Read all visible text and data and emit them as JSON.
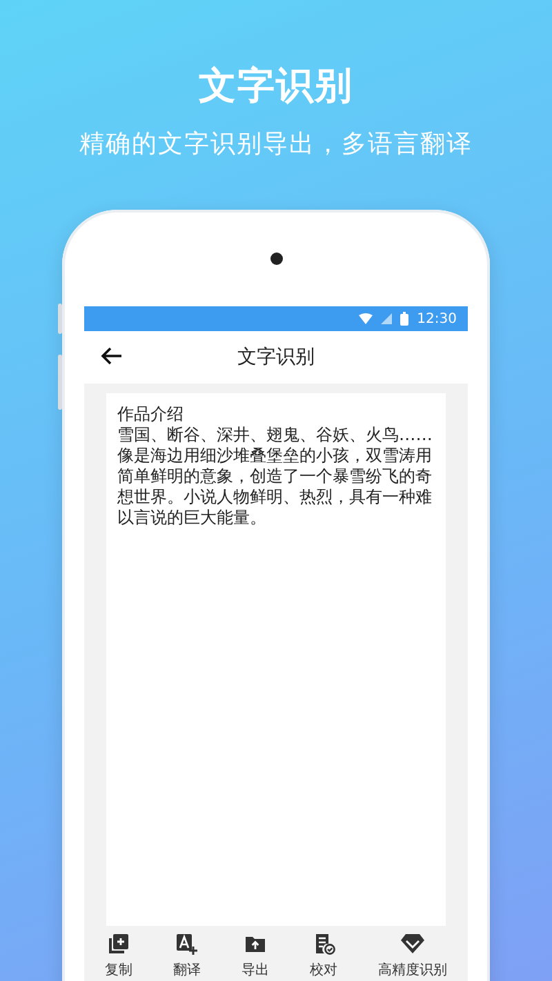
{
  "headline": {
    "title": "文字识别",
    "subtitle": "精确的文字识别导出，多语言翻译"
  },
  "status_bar": {
    "time": "12:30"
  },
  "app_bar": {
    "title": "文字识别"
  },
  "document": {
    "heading": "作品介绍",
    "body": "雪国、断谷、深井、翅鬼、谷妖、火鸟……\n像是海边用细沙堆叠堡垒的小孩，双雪涛用简单鲜明的意象，创造了一个暴雪纷飞的奇想世界。小说人物鲜明、热烈，具有一种难以言说的巨大能量。"
  },
  "toolbar": [
    {
      "kind": "copy",
      "label": "复制"
    },
    {
      "kind": "translate",
      "label": "翻译"
    },
    {
      "kind": "export",
      "label": "导出"
    },
    {
      "kind": "proofread",
      "label": "校对"
    },
    {
      "kind": "precision",
      "label": "高精度识别"
    }
  ]
}
